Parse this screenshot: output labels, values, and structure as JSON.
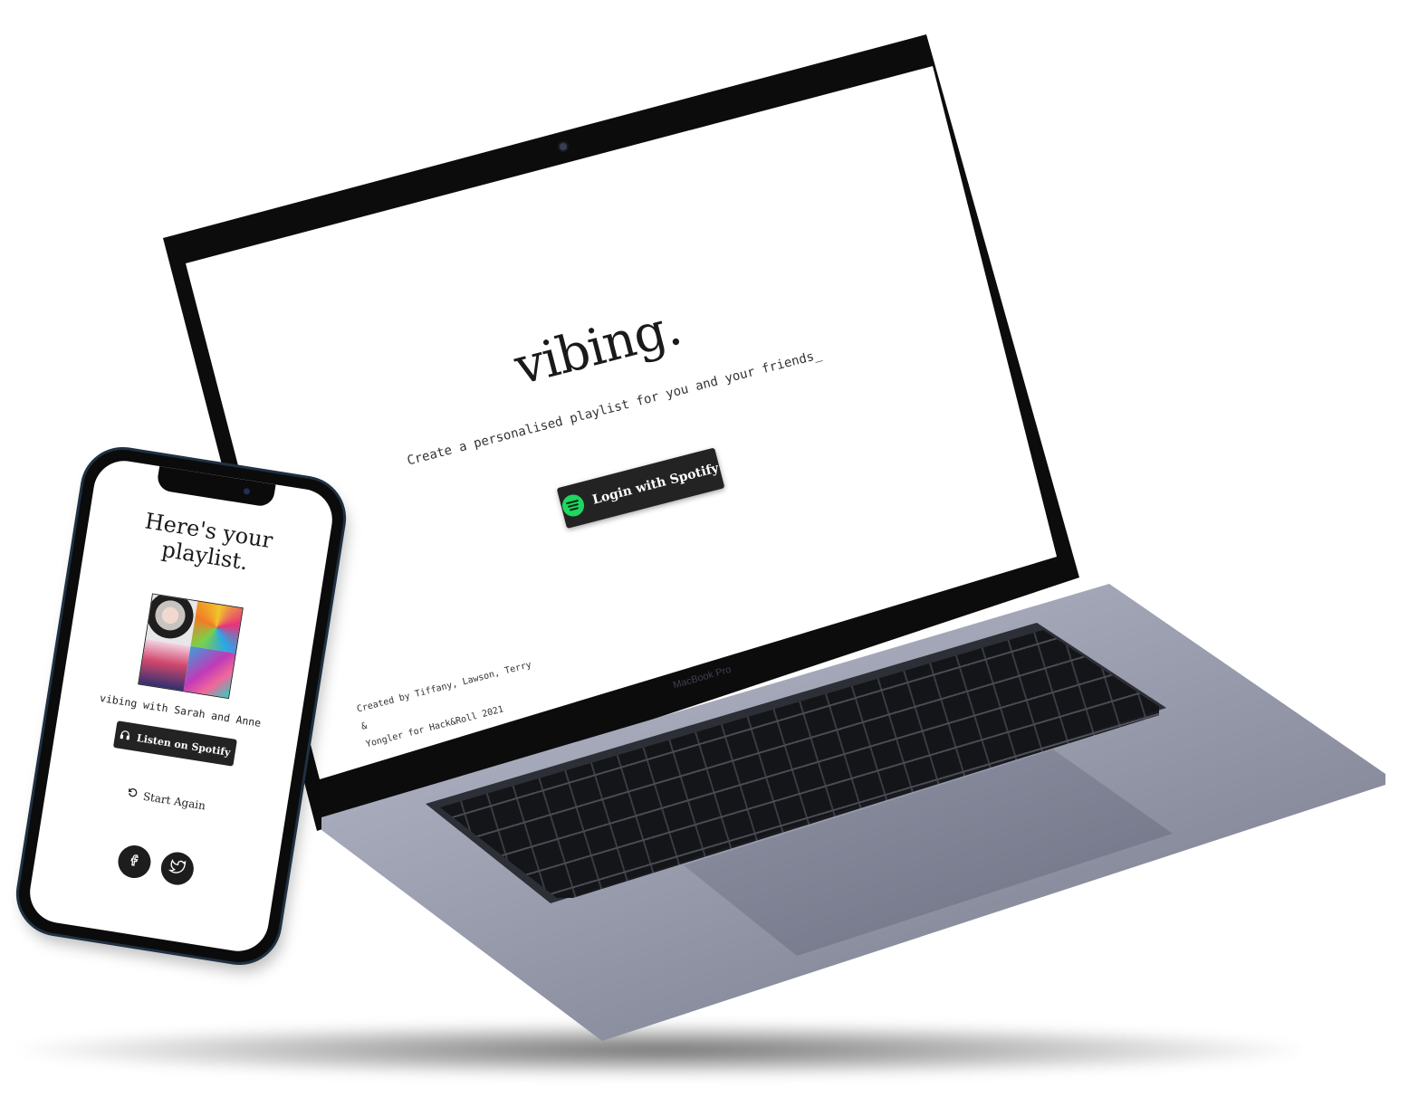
{
  "laptop": {
    "app_title": "vibing.",
    "subtitle": "Create a personalised playlist for you and your friends_",
    "login_button_label": "Login with Spotify",
    "credit_line1": "Created by Tiffany, Lawson, Terry &",
    "credit_line2": "Yongler for Hack&Roll 2021",
    "brand_label": "MacBook Pro",
    "spotify_icon": "spotify-icon"
  },
  "phone": {
    "title_line1": "Here's your",
    "title_line2": "playlist.",
    "playlist_caption": "vibing with Sarah and Anne",
    "listen_button_label": "Listen on Spotify",
    "start_again_label": "Start Again",
    "icons": {
      "headphones": "headphones-icon",
      "restart": "restart-icon",
      "facebook": "facebook-icon",
      "twitter": "twitter-icon"
    }
  },
  "colors": {
    "button_bg": "#232323",
    "spotify_green": "#1ed760",
    "text": "#1a1a1a"
  }
}
